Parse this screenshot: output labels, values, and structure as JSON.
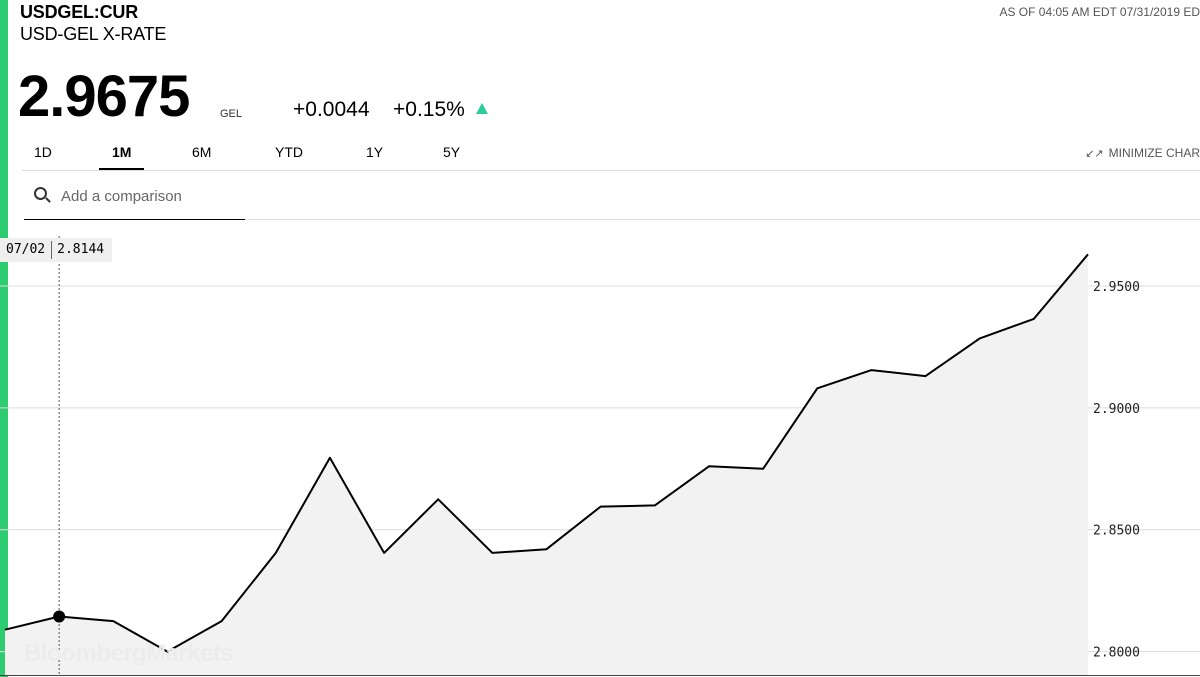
{
  "header": {
    "ticker": "USDGEL:CUR",
    "name": "USD-GEL X-RATE",
    "as_of": "AS OF 04:05 AM EDT 07/31/2019 ED",
    "price": "2.9675",
    "currency": "GEL",
    "change_abs": "+0.0044",
    "change_pct": "+0.15%",
    "direction_icon": "triangle-up-icon",
    "accent_color": "#2ecc71"
  },
  "tabs": [
    {
      "label": "1D",
      "active": false
    },
    {
      "label": "1M",
      "active": true
    },
    {
      "label": "6M",
      "active": false
    },
    {
      "label": "YTD",
      "active": false
    },
    {
      "label": "1Y",
      "active": false
    },
    {
      "label": "5Y",
      "active": false
    }
  ],
  "minimize_label": "MINIMIZE CHAR",
  "search": {
    "placeholder": "Add a comparison",
    "icon": "search-icon"
  },
  "tooltip": {
    "date": "07/02",
    "value": "2.8144"
  },
  "watermark": "BloombergMarkets",
  "chart_data": {
    "type": "area",
    "line_color": "#000000",
    "fill_color": "#f2f2f2",
    "grid": true,
    "ylim": [
      2.79,
      2.975
    ],
    "y_ticks": [
      "2.8000",
      "2.8500",
      "2.9000",
      "2.9500"
    ],
    "y_tick_values": [
      2.8,
      2.85,
      2.9,
      2.95
    ],
    "highlight_index": 1,
    "values": [
      2.809,
      2.8144,
      2.8125,
      2.8,
      2.8125,
      2.8405,
      2.8795,
      2.8405,
      2.8625,
      2.8405,
      2.842,
      2.8595,
      2.86,
      2.876,
      2.875,
      2.908,
      2.9155,
      2.913,
      2.9285,
      2.9365,
      2.963
    ]
  }
}
